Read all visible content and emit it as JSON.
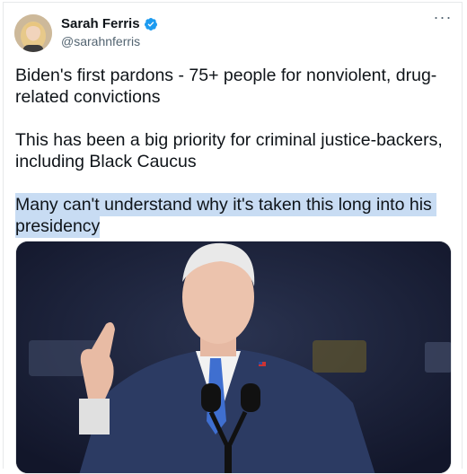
{
  "author": {
    "display_name": "Sarah Ferris",
    "handle": "@sarahnferris",
    "verified": true,
    "avatar_icon": "profile-photo"
  },
  "menu": {
    "more_label": "···"
  },
  "tweet": {
    "paragraphs": [
      "Biden's first pardons - 75+ people for nonviolent, drug-related convictions",
      "This has been a big priority for criminal justice-backers, including Black Caucus",
      "Many can't understand why it's taken this long into his presidency"
    ],
    "highlighted_paragraph_index": 2
  },
  "media": {
    "type": "photo",
    "icon": "photo-of-speaker-at-podium"
  },
  "colors": {
    "verified_blue": "#1d9bf0",
    "text": "#0f1419",
    "secondary_text": "#536471",
    "highlight": "#c8dcf3",
    "border": "#e7e9ea"
  }
}
